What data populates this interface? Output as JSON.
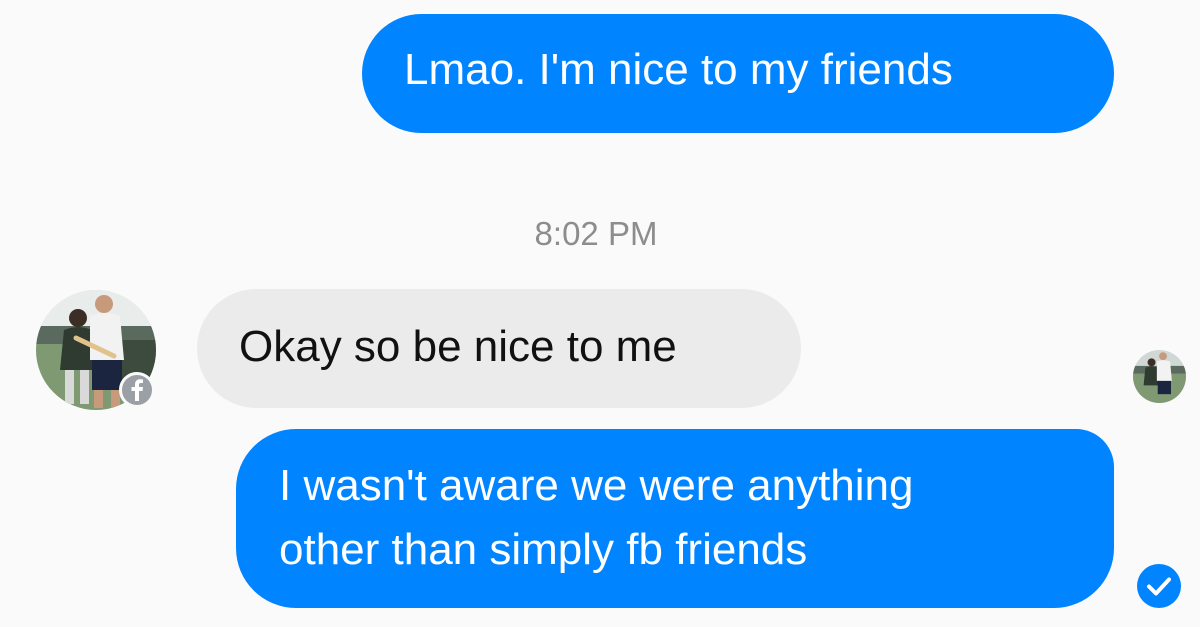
{
  "conversation": {
    "messages": [
      {
        "direction": "sent",
        "text": "Lmao. I'm nice to my friends"
      },
      {
        "direction": "received",
        "text": "Okay so be nice to me"
      },
      {
        "direction": "sent",
        "text": "I wasn't aware we were anything\nother than simply fb friends"
      }
    ],
    "timestamp": "8:02 PM"
  },
  "contact": {
    "avatar_icon": "profile-photo",
    "platform_badge_icon": "facebook-icon"
  },
  "status": {
    "seen_icon": "seen-avatar-icon",
    "delivered_icon": "check-circle-icon"
  },
  "colors": {
    "sent_bubble": "#0084ff",
    "received_bubble": "#ebebeb",
    "background": "#fafafa",
    "timestamp_text": "#8d8d8d"
  }
}
